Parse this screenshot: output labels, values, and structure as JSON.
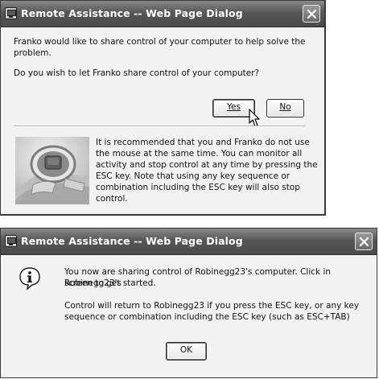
{
  "dialog1": {
    "title": "Remote Assistance -- Web Page Dialog",
    "line1": "Franko would like to share control of your computer to help solve the",
    "line2": "problem.",
    "question": "Do you wish to let Franko share control of your computer?",
    "yes_label": "Yes",
    "no_label": "No",
    "info_lines": [
      "It is recommended that you and Franko  do not use",
      "the mouse at the same time. You can monitor all",
      "activity and stop control at any time by pressing the",
      "ESC key. Note that using any key sequence or",
      "combination including the ESC key will also stop",
      "control."
    ]
  },
  "dialog2": {
    "title": "Remote Assistance -- Web Page Dialog",
    "lines": [
      "You now are sharing control of Robinegg23's computer. Click in Robinegg23's",
      "screen to get started.",
      "",
      "Control will return to Robinegg23 if you press the ESC key, or any key",
      "sequence or combination including the ESC key (such as ESC+TAB)"
    ],
    "ok_label": "OK"
  },
  "icons": {
    "window": "window-app-icon",
    "close": "close-icon",
    "cursor": "mouse-pointer-icon",
    "info": "info-speech-icon",
    "photo": "keyboard-esc-key-photo"
  }
}
